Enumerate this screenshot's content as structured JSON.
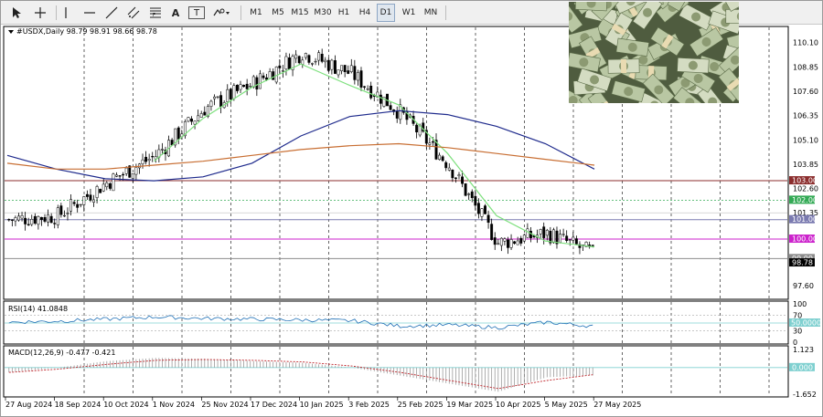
{
  "toolbar": {
    "tools": [
      {
        "name": "cursor-tool",
        "icon": "arrow-cursor-icon"
      },
      {
        "name": "crosshair-tool",
        "icon": "crosshair-icon"
      },
      {
        "name": "vertical-line-tool",
        "icon": "vertical-line-icon"
      },
      {
        "name": "horizontal-line-tool",
        "icon": "horizontal-line-icon"
      },
      {
        "name": "trendline-tool",
        "icon": "trendline-icon"
      },
      {
        "name": "channel-tool",
        "icon": "equidistant-channel-icon"
      },
      {
        "name": "fibonacci-tool",
        "icon": "fibonacci-icon"
      },
      {
        "name": "text-tool",
        "icon": "text-icon",
        "label": "A"
      },
      {
        "name": "text-label-tool",
        "icon": "text-label-icon",
        "label": "T"
      },
      {
        "name": "shapes-tool",
        "icon": "shapes-dropdown-icon"
      }
    ],
    "timeframes": [
      "M1",
      "M5",
      "M15",
      "M30",
      "H1",
      "H4",
      "D1",
      "W1",
      "MN"
    ],
    "active_timeframe": "D1"
  },
  "chart": {
    "symbol_line": "#USDX,Daily  98.79 98.91 98.66 98.78",
    "price_axis": [
      "110.10",
      "108.85",
      "107.60",
      "106.35",
      "105.10",
      "103.85",
      "102.60",
      "101.35",
      "97.60"
    ],
    "price_tags": [
      {
        "value": 103.0,
        "label": "103.00",
        "color": "#8b2d2d"
      },
      {
        "value": 102.0,
        "label": "102.00",
        "color": "#33aa55"
      },
      {
        "value": 101.0,
        "label": "101.00",
        "color": "#7a7ab0"
      },
      {
        "value": 100.0,
        "label": "100.00",
        "color": "#cc22cc"
      },
      {
        "value": 99.0,
        "label": "99.00",
        "color": "#8c8c8c"
      },
      {
        "value": 98.78,
        "label": "98.78",
        "color": "#000000"
      }
    ],
    "date_labels": [
      "27 Aug 2024",
      "18 Sep 2024",
      "10 Oct 2024",
      "1 Nov 2024",
      "25 Nov 2024",
      "17 Dec 2024",
      "10 Jan 2025",
      "3 Feb 2025",
      "25 Feb 2025",
      "19 Mar 2025",
      "10 Apr 2025",
      "5 May 2025",
      "27 May 2025"
    ],
    "colors": {
      "ma_fast": "#7ee07e",
      "ma_mid": "#1e2a8c",
      "ma_slow": "#c86e32",
      "candle": "#000000"
    }
  },
  "rsi": {
    "label": "RSI(14) 41.0848",
    "axis": [
      "100",
      "70",
      "50.0000",
      "30",
      "0"
    ],
    "line_color": "#1e6fb5"
  },
  "macd": {
    "label": "MACD(12,26,9) -0.477 -0.421",
    "axis": [
      "1.123",
      "0.000",
      "-1.652"
    ],
    "signal_color": "#c0272d"
  },
  "chart_data": {
    "type": "candlestick",
    "title": "#USDX,Daily",
    "y_range": [
      97.0,
      110.6
    ],
    "x": [
      "27 Aug 2024",
      "18 Sep 2024",
      "10 Oct 2024",
      "1 Nov 2024",
      "25 Nov 2024",
      "17 Dec 2024",
      "10 Jan 2025",
      "3 Feb 2025",
      "25 Feb 2025",
      "19 Mar 2025",
      "10 Apr 2025",
      "5 May 2025",
      "27 May 2025"
    ],
    "close_trend": [
      101.0,
      101.2,
      102.9,
      104.3,
      106.7,
      108.0,
      109.6,
      108.5,
      106.5,
      103.8,
      99.8,
      100.3,
      99.2
    ],
    "last": {
      "open": 98.79,
      "high": 98.91,
      "low": 98.66,
      "close": 98.78
    },
    "moving_averages": [
      {
        "name": "ma-fast",
        "values": [
          101.2,
          101.0,
          102.4,
          104.0,
          106.2,
          107.8,
          109.0,
          107.9,
          106.9,
          104.4,
          101.2,
          99.9,
          99.6
        ]
      },
      {
        "name": "ma-mid",
        "values": [
          104.3,
          103.6,
          103.1,
          103.0,
          103.2,
          103.9,
          105.3,
          106.3,
          106.6,
          106.4,
          105.8,
          104.9,
          103.6
        ]
      },
      {
        "name": "ma-slow",
        "values": [
          103.9,
          103.6,
          103.6,
          103.8,
          104.0,
          104.3,
          104.6,
          104.8,
          104.9,
          104.7,
          104.4,
          104.1,
          103.8
        ]
      }
    ],
    "horizontal_levels": [
      103.0,
      102.0,
      101.0,
      100.0,
      99.0
    ],
    "rsi": {
      "ylim": [
        0,
        100
      ],
      "levels": [
        70,
        50,
        30
      ],
      "values": [
        52,
        55,
        60,
        66,
        62,
        60,
        58,
        56,
        42,
        45,
        38,
        52,
        41
      ]
    },
    "macd": {
      "ylim": [
        -1.652,
        1.123
      ],
      "main": [
        -0.3,
        0.0,
        0.4,
        0.6,
        0.55,
        0.4,
        0.3,
        0.0,
        -0.5,
        -1.0,
        -1.5,
        -0.6,
        -0.48
      ],
      "signal": [
        -0.3,
        -0.1,
        0.2,
        0.45,
        0.5,
        0.45,
        0.35,
        0.1,
        -0.3,
        -0.8,
        -1.3,
        -0.8,
        -0.42
      ]
    }
  }
}
